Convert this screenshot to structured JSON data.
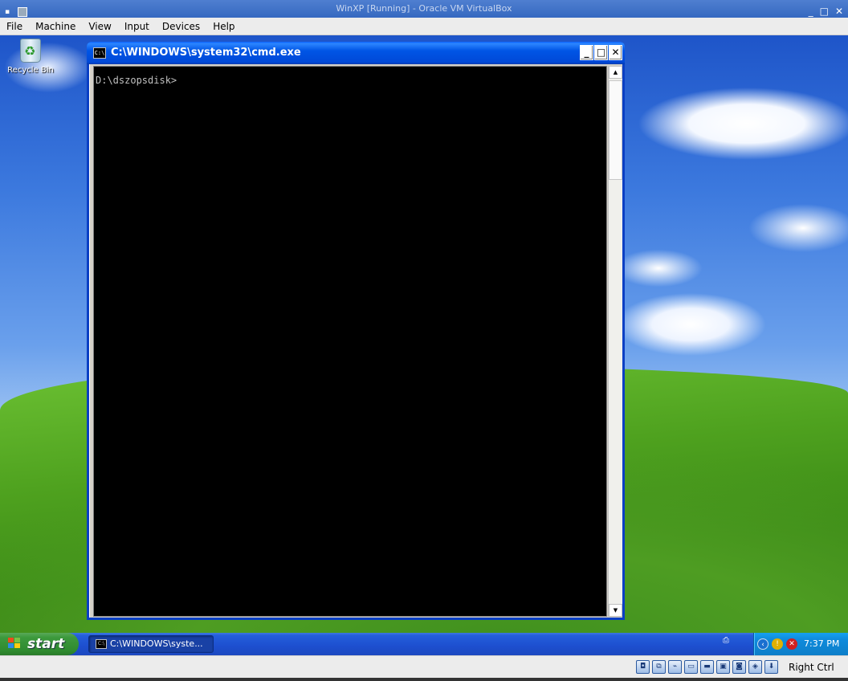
{
  "host": {
    "title": "WinXP [Running] - Oracle VM VirtualBox",
    "menu": [
      "File",
      "Machine",
      "View",
      "Input",
      "Devices",
      "Help"
    ],
    "titlebar_buttons": {
      "minimize": "_",
      "maximize": "□",
      "close": "✕"
    },
    "status_icons": [
      "hard-disk-icon",
      "network-icon",
      "usb-icon",
      "shared-folders-icon",
      "display-icon",
      "recording-icon",
      "video-capture-icon",
      "virtualization-icon",
      "mouse-integration-icon"
    ],
    "host_key": "Right Ctrl"
  },
  "desktop": {
    "recycle_bin_label": "Recycle Bin"
  },
  "cmd_window": {
    "title": "C:\\WINDOWS\\system32\\cmd.exe",
    "icon_text": "C:\\",
    "prompt": "D:\\dszopsdisk>",
    "controls": {
      "minimize": "_",
      "maximize": "□",
      "close": "✕"
    }
  },
  "taskbar": {
    "start_label": "start",
    "tasks": [
      {
        "label": "C:\\WINDOWS\\syste..."
      }
    ],
    "tray_icons": [
      "collapse-arrow-icon",
      "security-shield-icon",
      "security-alert-icon"
    ],
    "clock": "7:37 PM"
  },
  "colors": {
    "taskbar_blue": "#245edb",
    "start_green": "#3d9a3d",
    "tray_blue": "#0f8bdc",
    "cmd_title_blue": "#0055e5",
    "console_bg": "#000000",
    "console_fg": "#c0c0c0"
  }
}
